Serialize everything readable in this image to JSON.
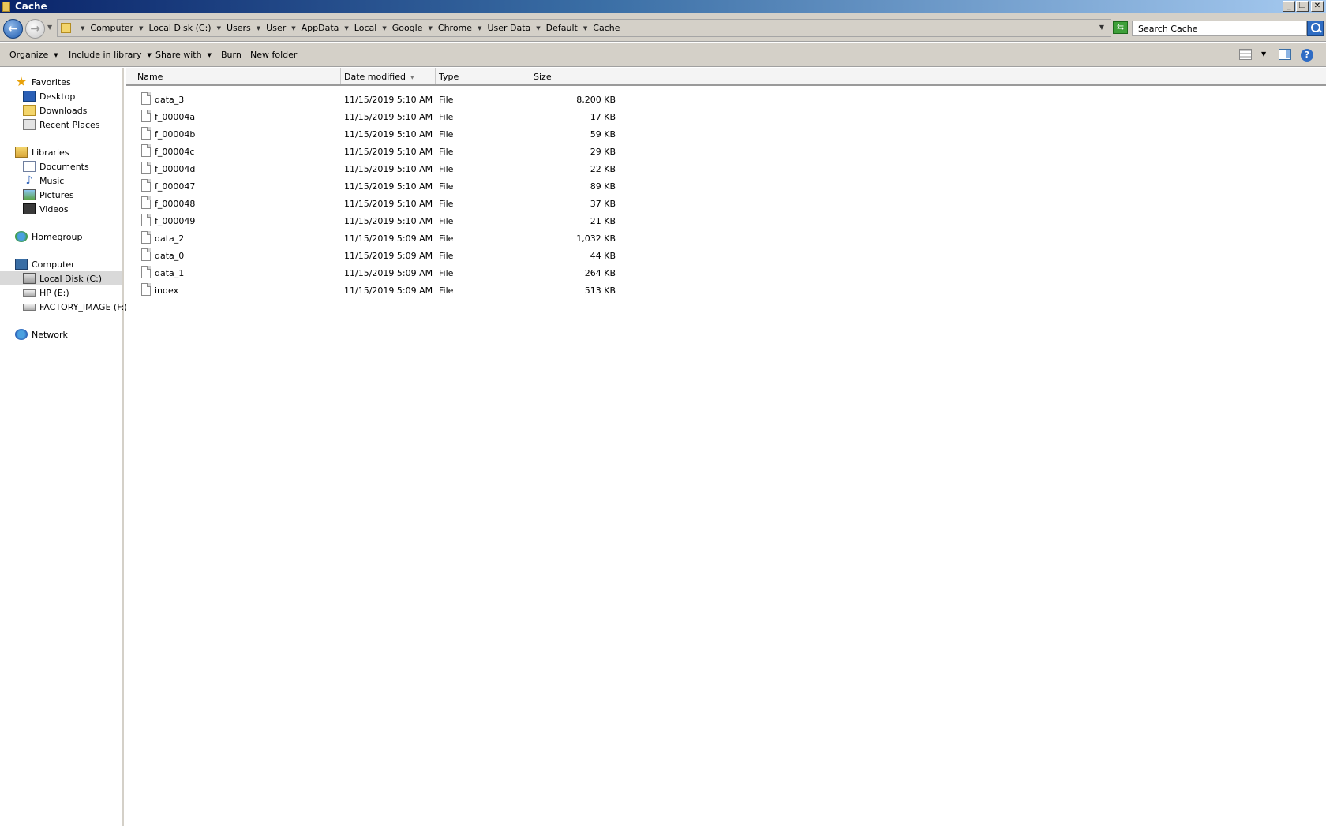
{
  "window": {
    "title": "Cache",
    "controls": {
      "minimize": "_",
      "restore": "❐",
      "close": "✕"
    }
  },
  "address": {
    "crumbs": [
      "Computer",
      "Local Disk (C:)",
      "Users",
      "User",
      "AppData",
      "Local",
      "Google",
      "Chrome",
      "User Data",
      "Default",
      "Cache"
    ],
    "search_placeholder": "Search Cache"
  },
  "toolbar": {
    "organize": "Organize",
    "include_in_library": "Include in library",
    "share_with": "Share with",
    "burn": "Burn",
    "new_folder": "New folder"
  },
  "nav": {
    "favorites": "Favorites",
    "desktop": "Desktop",
    "downloads": "Downloads",
    "recent_places": "Recent Places",
    "libraries": "Libraries",
    "documents": "Documents",
    "music": "Music",
    "pictures": "Pictures",
    "videos": "Videos",
    "homegroup": "Homegroup",
    "computer": "Computer",
    "local_disk": "Local Disk (C:)",
    "hp": "HP (E:)",
    "factory_image": "FACTORY_IMAGE (F:)",
    "network": "Network"
  },
  "columns": {
    "name": "Name",
    "date_modified": "Date modified",
    "type": "Type",
    "size": "Size"
  },
  "files": [
    {
      "name": "data_3",
      "date": "11/15/2019 5:10 AM",
      "type": "File",
      "size": "8,200 KB"
    },
    {
      "name": "f_00004a",
      "date": "11/15/2019 5:10 AM",
      "type": "File",
      "size": "17 KB"
    },
    {
      "name": "f_00004b",
      "date": "11/15/2019 5:10 AM",
      "type": "File",
      "size": "59 KB"
    },
    {
      "name": "f_00004c",
      "date": "11/15/2019 5:10 AM",
      "type": "File",
      "size": "29 KB"
    },
    {
      "name": "f_00004d",
      "date": "11/15/2019 5:10 AM",
      "type": "File",
      "size": "22 KB"
    },
    {
      "name": "f_000047",
      "date": "11/15/2019 5:10 AM",
      "type": "File",
      "size": "89 KB"
    },
    {
      "name": "f_000048",
      "date": "11/15/2019 5:10 AM",
      "type": "File",
      "size": "37 KB"
    },
    {
      "name": "f_000049",
      "date": "11/15/2019 5:10 AM",
      "type": "File",
      "size": "21 KB"
    },
    {
      "name": "data_2",
      "date": "11/15/2019 5:09 AM",
      "type": "File",
      "size": "1,032 KB"
    },
    {
      "name": "data_0",
      "date": "11/15/2019 5:09 AM",
      "type": "File",
      "size": "44 KB"
    },
    {
      "name": "data_1",
      "date": "11/15/2019 5:09 AM",
      "type": "File",
      "size": "264 KB"
    },
    {
      "name": "index",
      "date": "11/15/2019 5:09 AM",
      "type": "File",
      "size": "513 KB"
    }
  ],
  "icons": {
    "back": "back-arrow-icon",
    "forward": "forward-arrow-icon",
    "search": "magnifier-icon",
    "help": "help-icon",
    "file": "blank-file-icon"
  },
  "colors": {
    "titlebar_start": "#0a246a",
    "titlebar_end": "#a6caf0",
    "chrome": "#d4d0c8",
    "selection": "#d9d9d9"
  }
}
